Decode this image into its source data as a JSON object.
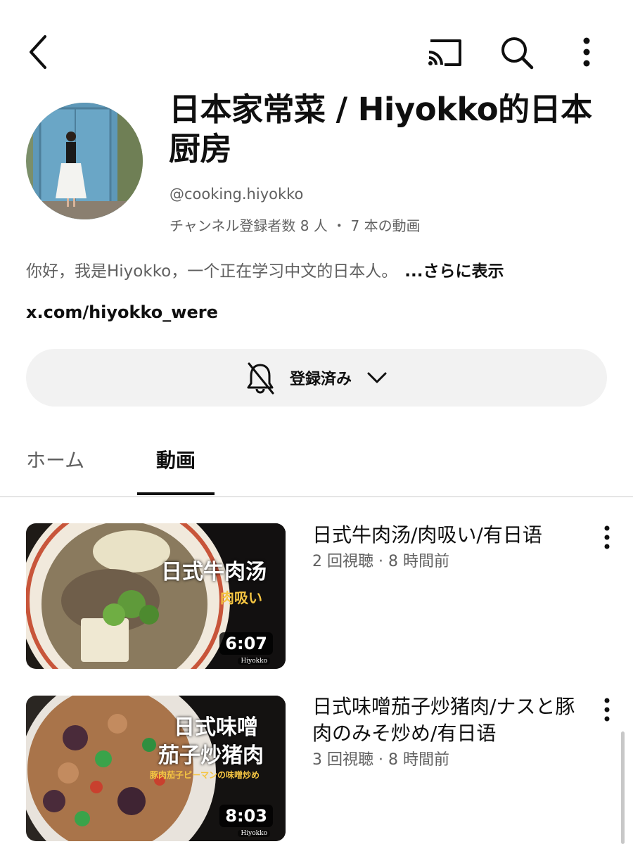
{
  "header": {
    "back_icon": "back-arrow-icon",
    "cast_icon": "cast-icon",
    "search_icon": "search-icon",
    "more_icon": "more-vertical-icon"
  },
  "channel": {
    "title": "日本家常菜 / Hiyokko的日本厨房",
    "handle": "@cooking.hiyokko",
    "stats": "チャンネル登録者数 8 人 ・ 7 本の動画",
    "description": "你好，我是Hiyokko，一个正在学习中文的日本人。",
    "description_more": "...さらに表示",
    "link": "x.com/hiyokko_were"
  },
  "subscribe": {
    "label": "登録済み",
    "bell_icon": "bell-off-icon",
    "chevron_icon": "chevron-down-icon"
  },
  "tabs": [
    {
      "label": "ホーム",
      "active": false
    },
    {
      "label": "動画",
      "active": true
    }
  ],
  "videos": [
    {
      "title": "日式牛肉汤/肉吸い/有日语",
      "meta": "2 回視聴 · 8 時間前",
      "duration": "6:07",
      "thumb_text_main": "日式牛肉汤",
      "thumb_text_sub": "肉吸い",
      "watermark": "Hiyokko"
    },
    {
      "title": "日式味噌茄子炒猪肉/ナスと豚肉のみそ炒め/有日语",
      "meta": "3 回視聴 · 8 時間前",
      "duration": "8:03",
      "thumb_text_main_1": "日式味噌",
      "thumb_text_main_2": "茄子炒猪肉",
      "thumb_text_sub": "豚肉茄子ピーマンの味噌炒め",
      "watermark": "Hiyokko"
    }
  ],
  "colors": {
    "text_primary": "#0f0f0f",
    "text_secondary": "#606060",
    "button_bg": "#f2f2f2",
    "thumb_accent": "#f5c542"
  }
}
